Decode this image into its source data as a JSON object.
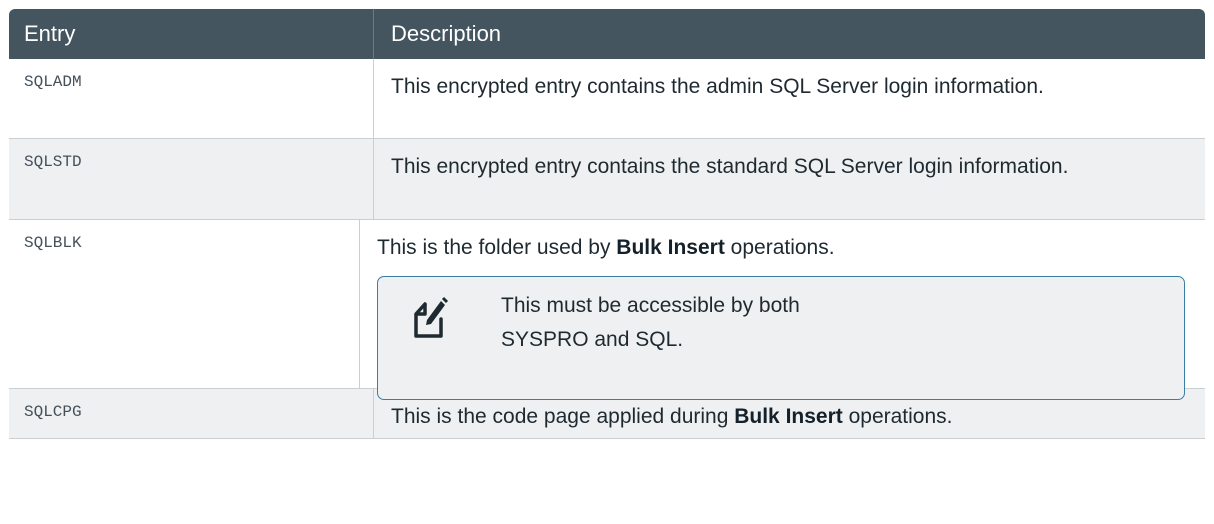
{
  "table": {
    "headers": {
      "entry": "Entry",
      "description": "Description"
    },
    "rows": [
      {
        "entry": "SQLADM",
        "description": "This encrypted entry contains the admin SQL Server login information."
      },
      {
        "entry": "SQLSTD",
        "description": "This encrypted entry contains the standard SQL Server login information."
      },
      {
        "entry": "SQLBLK",
        "description_before": "This is the folder used by ",
        "description_bold": "Bulk Insert",
        "description_after": " operations.",
        "note": "This must be accessible by both SYSPRO and SQL.",
        "note_icon": "note-edit-icon"
      },
      {
        "entry": "SQLCPG",
        "description_before": "This is the code page applied during ",
        "description_bold": "Bulk Insert",
        "description_after": " operations."
      }
    ]
  },
  "colors": {
    "header_bg": "#455560",
    "row_alt_bg": "#eef0f1",
    "note_border": "#3a7fa3"
  }
}
